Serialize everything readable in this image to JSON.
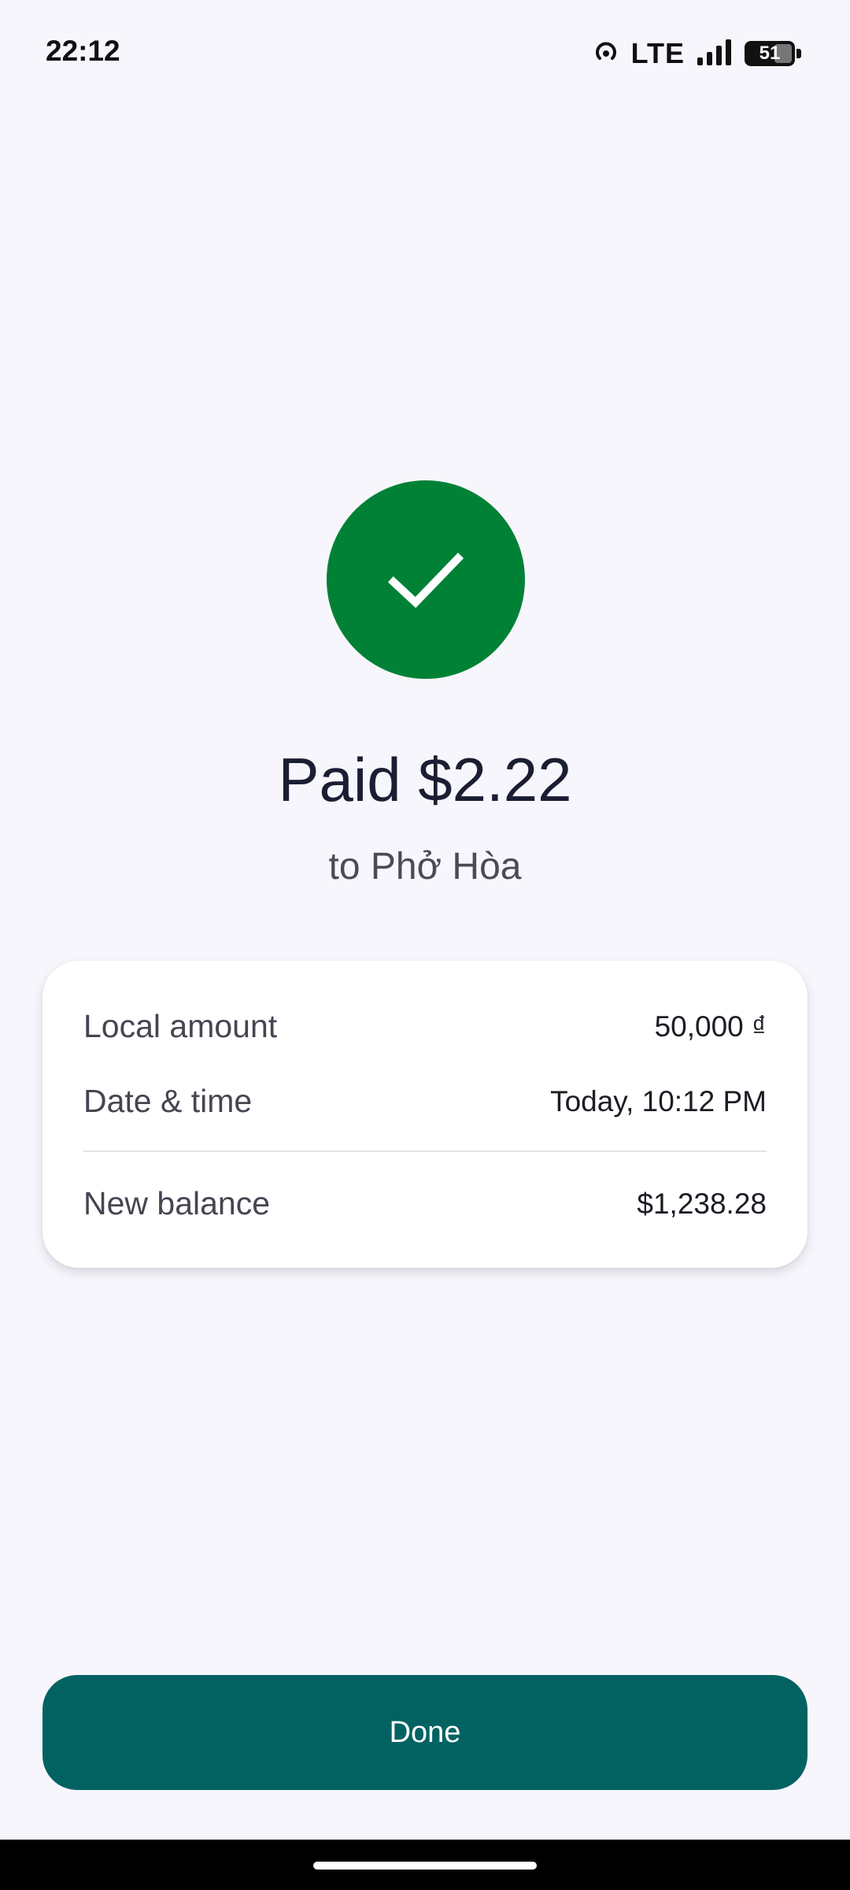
{
  "status_bar": {
    "time": "22:12",
    "network": "LTE",
    "battery": "51"
  },
  "success": {
    "title": "Paid $2.22",
    "subtitle": "to Phở Hòa",
    "accent_color": "#018136"
  },
  "details": {
    "local_amount": {
      "label": "Local amount",
      "value": "50,000 ₫"
    },
    "date_time": {
      "label": "Date & time",
      "value": "Today, 10:12 PM"
    },
    "new_balance": {
      "label": "New balance",
      "value": "$1,238.28"
    }
  },
  "actions": {
    "done_label": "Done",
    "button_color": "#026262"
  }
}
